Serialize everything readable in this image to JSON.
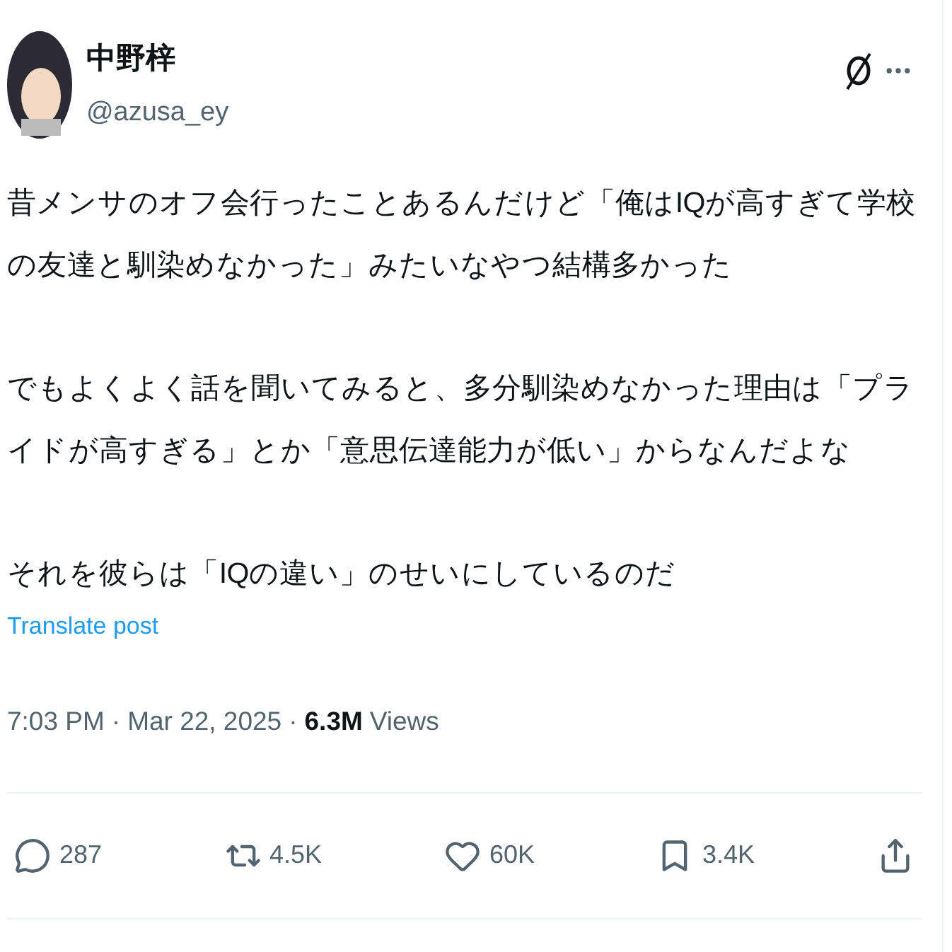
{
  "author": {
    "name": "中野梓",
    "handle": "@azusa_ey"
  },
  "body": [
    "昔メンサのオフ会行ったことあるんだけど「俺はIQが高すぎて学校の友達と馴染めなかった」みたいなやつ結構多かった",
    "でもよくよく話を聞いてみると、多分馴染めなかった理由は「プライドが高すぎる」とか「意思伝達能力が低い」からなんだよな",
    "それを彼らは「IQの違い」のせいにしているのだ"
  ],
  "translate": "Translate post",
  "meta": {
    "time": "7:03 PM",
    "date": "Mar 22, 2025",
    "views": "6.3M",
    "views_label": "Views",
    "separator": "·"
  },
  "actions": [
    {
      "kind": "reply",
      "count": "287"
    },
    {
      "kind": "repost",
      "count": "4.5K"
    },
    {
      "kind": "like",
      "count": "60K"
    },
    {
      "kind": "bookmark",
      "count": "3.4K"
    },
    {
      "kind": "share"
    }
  ]
}
